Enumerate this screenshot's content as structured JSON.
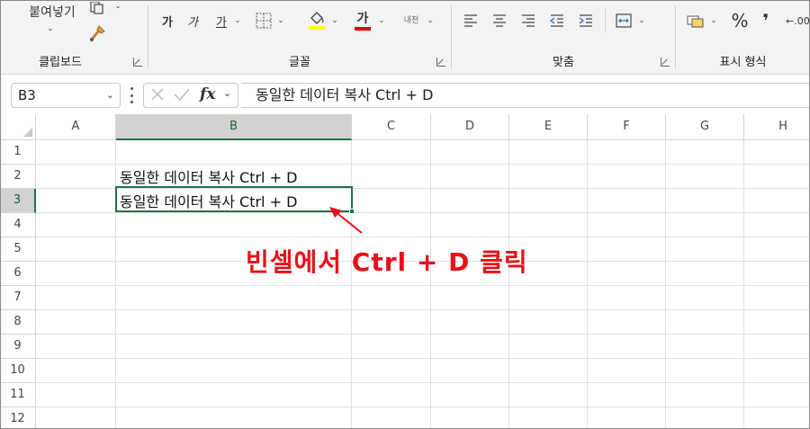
{
  "ribbon": {
    "clipboard": {
      "paste_label": "붙여넣기",
      "group_label": "클립보드"
    },
    "font": {
      "bold_label": "가",
      "italic_label": "가",
      "underline_label": "가",
      "font_color_label": "가",
      "phonetic_label": "내천",
      "highlight_color": "#ffff00",
      "font_color": "#e00000",
      "group_label": "글꼴"
    },
    "alignment": {
      "group_label": "맞춤"
    },
    "number": {
      "percent_label": "%",
      "comma_label": "❜",
      "decimal_label": "←.00",
      "group_label": "표시 형식"
    }
  },
  "formula_bar": {
    "name_box": "B3",
    "fx_label": "fx",
    "content": "동일한 데이터 복사 Ctrl + D"
  },
  "sheet": {
    "columns": [
      "A",
      "B",
      "C",
      "D",
      "E",
      "F",
      "G",
      "H"
    ],
    "selected_column": "B",
    "rows": [
      "1",
      "2",
      "3",
      "4",
      "5",
      "6",
      "7",
      "8",
      "9",
      "10",
      "11",
      "12"
    ],
    "selected_row": "3",
    "cells": {
      "B2": "동일한 데이터 복사 Ctrl + D",
      "B3": "동일한 데이터 복사 Ctrl + D"
    }
  },
  "annotation": {
    "text": "빈셀에서 Ctrl + D 클릭",
    "color": "#e8101a"
  },
  "accent_color": "#217346"
}
